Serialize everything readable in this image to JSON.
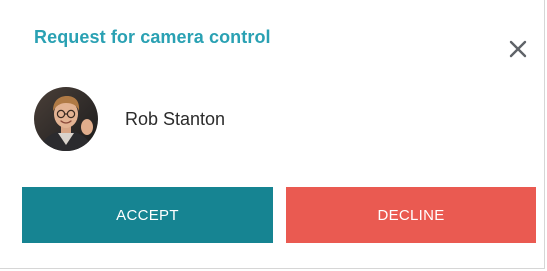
{
  "dialog": {
    "title": "Request for camera control",
    "close_icon": "close-icon"
  },
  "requester": {
    "name": "Rob Stanton",
    "avatar_icon": "avatar"
  },
  "actions": {
    "accept_label": "ACCEPT",
    "decline_label": "DECLINE"
  },
  "colors": {
    "title": "#2aa1b3",
    "accept": "#168492",
    "decline": "#ea5a51",
    "close": "#5f6368"
  }
}
